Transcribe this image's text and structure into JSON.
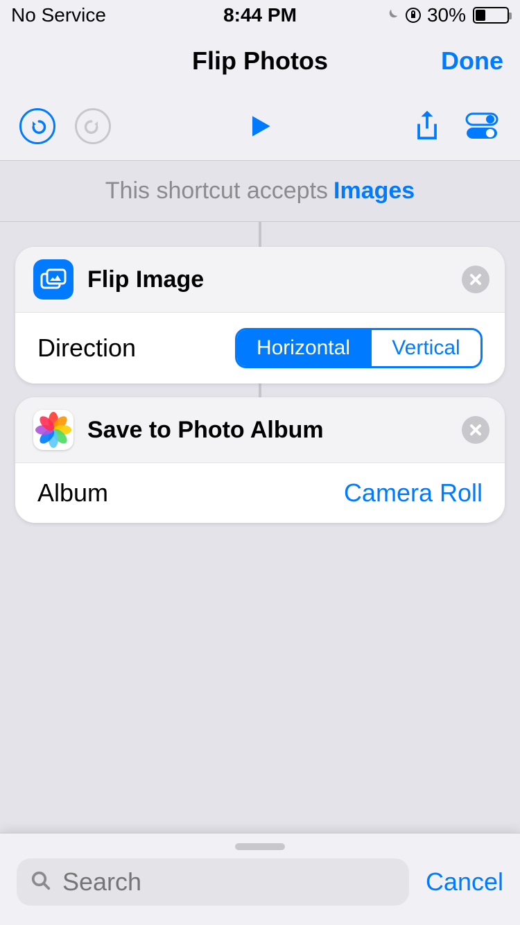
{
  "status_bar": {
    "service": "No Service",
    "time": "8:44 PM",
    "battery_pct": "30%"
  },
  "nav": {
    "title": "Flip Photos",
    "done": "Done"
  },
  "accepts": {
    "prefix": "This shortcut accepts",
    "type": "Images"
  },
  "cards": {
    "flip": {
      "title": "Flip Image",
      "direction_label": "Direction",
      "seg_horizontal": "Horizontal",
      "seg_vertical": "Vertical",
      "seg_selected": "Horizontal"
    },
    "save": {
      "title": "Save to Photo Album",
      "album_label": "Album",
      "album_value": "Camera Roll"
    }
  },
  "bottom": {
    "search_placeholder": "Search",
    "cancel": "Cancel"
  }
}
